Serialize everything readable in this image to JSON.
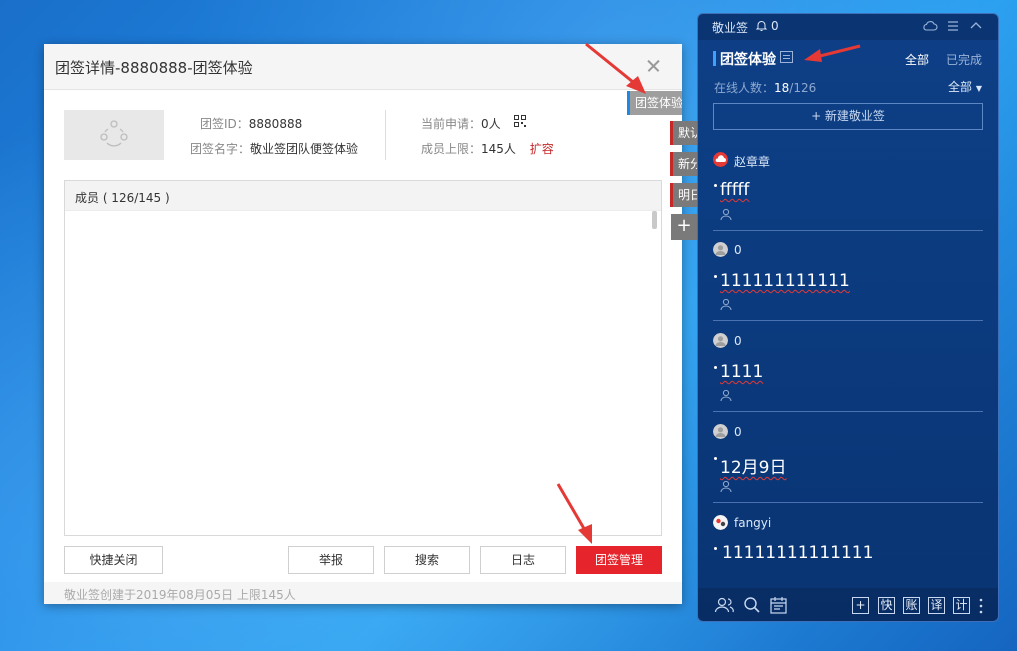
{
  "dialog": {
    "title": "团签详情-8880888-团签体验",
    "group_id_label": "团签ID：",
    "group_id": "8880888",
    "group_name_label": "团签名字：",
    "group_name": "敬业签团队便签体验",
    "pending_label": "当前申请：",
    "pending_value": "0人",
    "limit_label": "成员上限：",
    "limit_value": "145人",
    "expand_label": "扩容",
    "members_header": "成员 ( 126/145 )",
    "buttons": {
      "quick_close": "快捷关闭",
      "report": "举报",
      "search": "搜索",
      "log": "日志",
      "manage": "团签管理"
    },
    "footer_text": "敬业签创建于2019年08月05日  上限145人"
  },
  "side_tabs": [
    {
      "label": "团签体验"
    },
    {
      "label": "默认"
    },
    {
      "label": "新分"
    },
    {
      "label": "明日"
    }
  ],
  "side_plus": "+",
  "panel": {
    "app_name": "敬业签",
    "notification_count": "0",
    "group_name": "团签体验",
    "filter_all": "全部",
    "filter_done": "已完成",
    "online_label": "在线人数：",
    "online_current": "18",
    "online_total": "/126",
    "online_filter": "全部",
    "new_note": "+ 新建敬业签",
    "notes": [
      {
        "author": "赵章章",
        "text": "fffff"
      },
      {
        "author": "0",
        "text": "111111111111"
      },
      {
        "author": "0",
        "text": "1111"
      },
      {
        "author": "0",
        "text": "12月9日"
      },
      {
        "author": "fangyi",
        "text": "11111111111111"
      }
    ],
    "bottom_tools": [
      "+",
      "快",
      "账",
      "译",
      "计"
    ]
  },
  "colors": {
    "accent_red": "#e5242b",
    "panel_bg": "#0b3a7e",
    "desktop": "#1e88e5"
  }
}
